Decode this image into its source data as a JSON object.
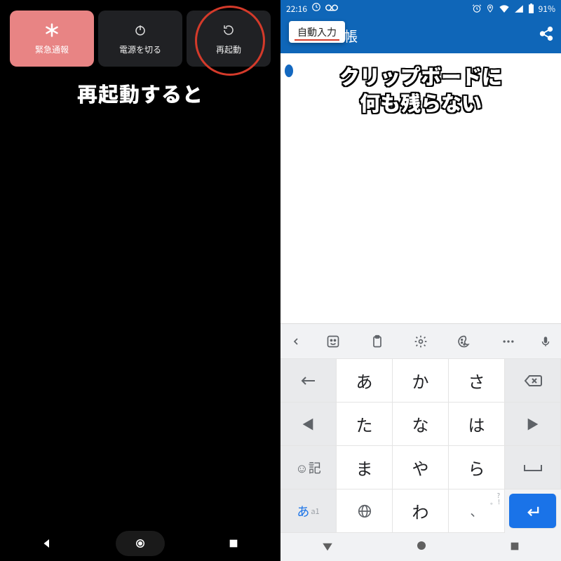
{
  "left": {
    "power_buttons": {
      "emergency": "緊急通報",
      "shutdown": "電源を切る",
      "restart": "再起動"
    },
    "caption": "再起動すると"
  },
  "right": {
    "statusbar": {
      "time": "22:16",
      "battery": "91%"
    },
    "appbar": {
      "title_fragment": "帳",
      "autofill_label": "自動入力"
    },
    "caption_line1": "クリップボードに",
    "caption_line2": "何も残らない",
    "keyboard": {
      "row1": {
        "c1": "↤",
        "c2": "あ",
        "c3": "か",
        "c4": "さ",
        "c5": "⌫"
      },
      "row2": {
        "c1": "◀",
        "c2": "た",
        "c3": "な",
        "c4": "は",
        "c5": "▶"
      },
      "row3": {
        "c1_a": "☺",
        "c1_b": "記",
        "c2": "ま",
        "c3": "や",
        "c4": "ら"
      },
      "row4": {
        "c1_a": "あ",
        "c1_b": "a1",
        "c2": "⊕",
        "c3": "わ",
        "c5": "↵"
      },
      "punct_super": "?\n。 !"
    }
  }
}
